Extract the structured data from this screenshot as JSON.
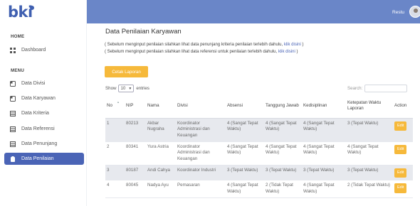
{
  "app": {
    "logo_text": "bki"
  },
  "sidebar": {
    "home_label": "HOME",
    "menu_label": "MENU",
    "items": [
      {
        "label": "Dashboard",
        "icon": "grid-icon"
      },
      {
        "label": "Data Divisi",
        "icon": "bookmark-icon"
      },
      {
        "label": "Data Karyawan",
        "icon": "bookmark-icon"
      },
      {
        "label": "Data Kriteria",
        "icon": "table-icon"
      },
      {
        "label": "Data Referensi",
        "icon": "table-icon"
      },
      {
        "label": "Data Penunjang",
        "icon": "table-icon"
      },
      {
        "label": "Data Penilaian",
        "icon": "clipboard-icon"
      }
    ],
    "active_index": 6
  },
  "topbar": {
    "user_name": "Restu"
  },
  "main": {
    "title": "Data Penilaian Karyawan",
    "note1_text": "( Sebelum menginput penilaian silahkan lihat data penunjang kriteria penilaian terlebih dahulu, ",
    "note1_link": "klik disini",
    "note1_end": " )",
    "note2_text": "( Sebelum menginput penilaian silahkan lihat data referensi untuk penilaian terlebih dahulu, ",
    "note2_link": "klik disini",
    "note2_end": " )",
    "print_button": "Cetak Laporan",
    "show_label": "Show",
    "show_value": "10",
    "entries_label": "entries",
    "search_label": "Search:"
  },
  "table": {
    "headers": [
      "No",
      "NIP",
      "Nama",
      "Divisi",
      "Absensi",
      "Tanggung Jawab",
      "Kedisiplinan",
      "Ketepatan Waktu Laporan",
      "Action"
    ],
    "action_label": "Edit",
    "rows": [
      [
        "1",
        "80213",
        "Akbar Nugraha",
        "Koordinator Administrasi dan Keuangan",
        "4 (Sangat Tepat Waktu)",
        "4 (Sangat Tepat Waktu)",
        "4 (Sangat Tepat Waktu)",
        "3 (Tepat Waktu)"
      ],
      [
        "2",
        "80341",
        "Yura Astria",
        "Koordinator Administrasi dan Keuangan",
        "4 (Sangat Tepat Waktu)",
        "4 (Sangat Tepat Waktu)",
        "4 (Sangat Tepat Waktu)",
        "4 (Sangat Tepat Waktu)"
      ],
      [
        "3",
        "80187",
        "Andi Cahya",
        "Koordinator Industri",
        "3 (Tepat Waktu)",
        "3 (Tepat Waktu)",
        "3 (Tepat Waktu)",
        "3 (Tepat Waktu)"
      ],
      [
        "4",
        "80045",
        "Nadya Ayu",
        "Pemasaran",
        "4 (Sangat Tepat Waktu)",
        "2 (Tidak Tepat Waktu)",
        "4 (Sangat Tepat Waktu)",
        "2 (Tidak Tepat Waktu)"
      ]
    ]
  },
  "colors": {
    "brand": "#4a64b6",
    "topbar": "#6a86c8",
    "accent": "#f6b93b"
  }
}
